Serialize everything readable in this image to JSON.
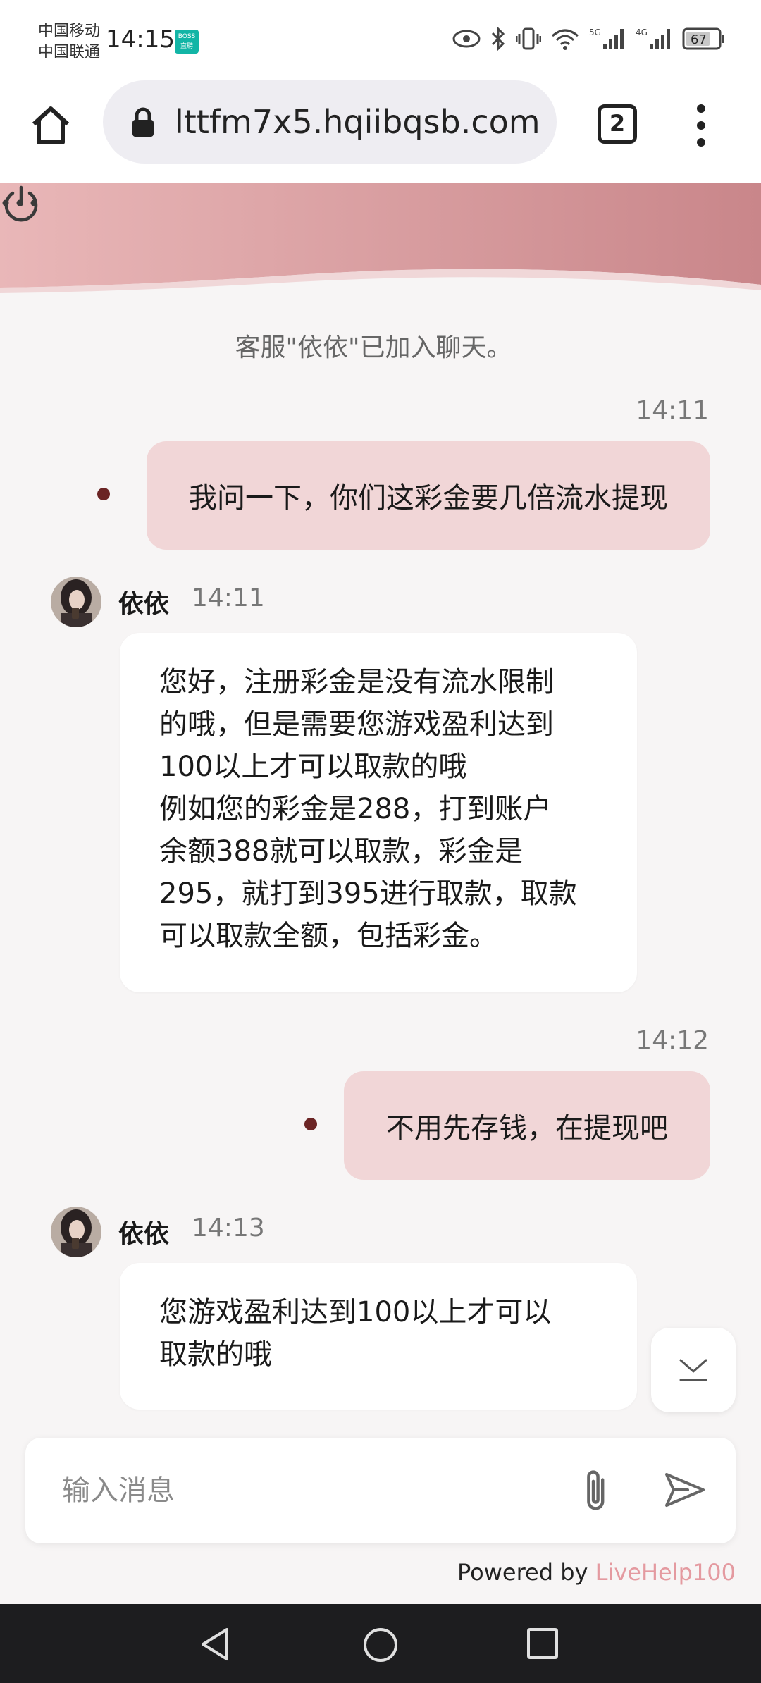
{
  "status_bar": {
    "carrier_1": "中国移动",
    "carrier_2": "中国联通",
    "time": "14:15",
    "boss_badge": "BOSS 直聘",
    "battery": "67",
    "signal_5g": "5G",
    "signal_4g": "4G"
  },
  "browser": {
    "url": "lttfm7x5.hqiibqsb.com",
    "tab_count": "2"
  },
  "chat": {
    "system_message": "客服\"依依\"已加入聊天。",
    "messages": [
      {
        "type": "out",
        "time": "14:11",
        "text": "我问一下，你们这彩金要几倍流水提现"
      },
      {
        "type": "in",
        "sender": "依依",
        "time": "14:11",
        "text": "您好，注册彩金是没有流水限制\n的哦，但是需要您游戏盈利达到\n100以上才可以取款的哦\n例如您的彩金是288，打到账户\n余额388就可以取款，彩金是\n295，就打到395进行取款，取款\n可以取款全额，包括彩金。"
      },
      {
        "type": "out",
        "time": "14:12",
        "text": "不用先存钱，在提现吧"
      },
      {
        "type": "in",
        "sender": "依依",
        "time": "14:13",
        "text": "您游戏盈利达到100以上才可以\n取款的哦"
      }
    ]
  },
  "input": {
    "placeholder": "输入消息"
  },
  "footer": {
    "powered_prefix": "Powered by ",
    "brand": "LiveHelp100"
  },
  "colors": {
    "header_gradient_start": "#e9b7b8",
    "header_gradient_end": "#c9868a",
    "outgoing_bubble": "#f1d6d7",
    "brand_text": "#e49aa0"
  }
}
